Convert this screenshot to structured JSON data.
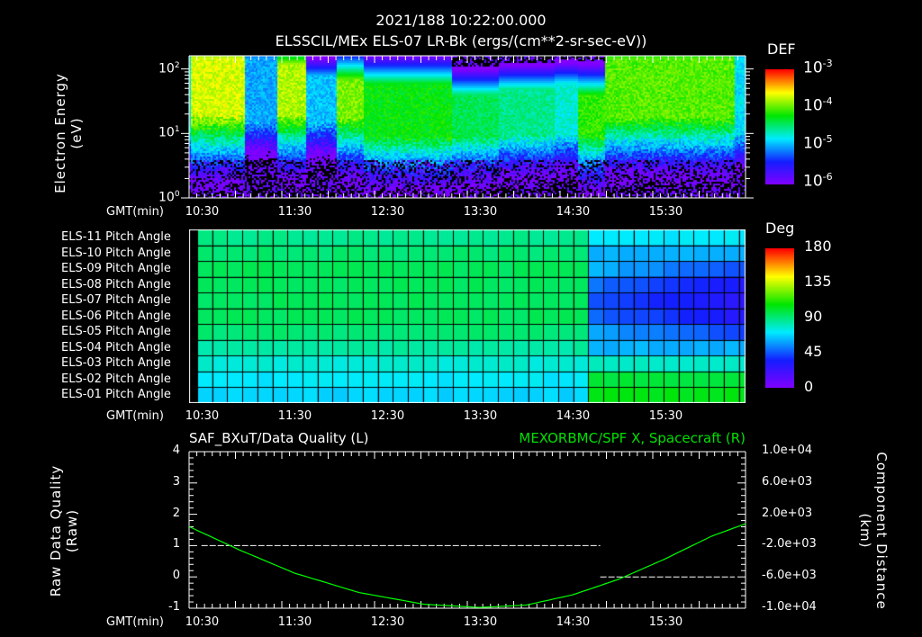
{
  "header": {
    "datetime": "2021/188 10:22:00.000"
  },
  "chart_data": [
    {
      "type": "heatmap",
      "title": "ELSSCIL/MEx ELS-07 LR-Bk  (ergs/(cm**2-sr-sec-eV))",
      "xlabel": "GMT(min)",
      "ylabel": [
        "Electron Energy",
        "(eV)"
      ],
      "y_scale": "log",
      "ylim": [
        1,
        160
      ],
      "y_ticks": [
        {
          "exp": "0",
          "label": "10"
        },
        {
          "exp": "1",
          "label": "10"
        },
        {
          "exp": "2",
          "label": "10"
        }
      ],
      "x_range_hours": [
        10.3667,
        16.3667
      ],
      "x_ticks": [
        "10:30",
        "11:30",
        "12:30",
        "13:30",
        "14:30",
        "15:30"
      ],
      "colorbar": {
        "label": "DEF",
        "scale": "log",
        "range": [
          1e-06,
          0.001
        ],
        "ticks": [
          {
            "base": "10",
            "exp": "-3"
          },
          {
            "base": "10",
            "exp": "-4"
          },
          {
            "base": "10",
            "exp": "-5"
          },
          {
            "base": "10",
            "exp": "-6"
          }
        ]
      },
      "segments": [
        {
          "start": 10.37,
          "end": 10.95,
          "peak_def": 0.0002,
          "band_eV": [
            20,
            150
          ]
        },
        {
          "start": 10.95,
          "end": 11.3,
          "peak_def": 1e-05,
          "band_eV": [
            15,
            150
          ]
        },
        {
          "start": 11.3,
          "end": 11.62,
          "peak_def": 0.00016,
          "band_eV": [
            20,
            120
          ]
        },
        {
          "start": 11.62,
          "end": 11.95,
          "peak_def": 1.2e-05,
          "band_eV": [
            15,
            80
          ]
        },
        {
          "start": 11.95,
          "end": 12.25,
          "peak_def": 0.00012,
          "band_eV": [
            18,
            70
          ]
        },
        {
          "start": 12.25,
          "end": 13.2,
          "peak_def": 6e-05,
          "band_eV": [
            9,
            60
          ]
        },
        {
          "start": 13.2,
          "end": 13.7,
          "peak_def": 4e-05,
          "band_eV": [
            9,
            40
          ]
        },
        {
          "start": 13.7,
          "end": 14.3,
          "peak_def": 3e-05,
          "band_eV": [
            10,
            50
          ]
        },
        {
          "start": 14.3,
          "end": 14.55,
          "peak_def": 2e-05,
          "band_eV": [
            10,
            60
          ]
        },
        {
          "start": 14.55,
          "end": 14.85,
          "peak_def": 8e-05,
          "band_eV": [
            10,
            40
          ]
        },
        {
          "start": 14.85,
          "end": 16.25,
          "peak_def": 0.0001,
          "band_eV": [
            18,
            150
          ]
        },
        {
          "start": 16.25,
          "end": 16.37,
          "peak_def": 1.5e-05,
          "band_eV": [
            10,
            150
          ]
        }
      ]
    },
    {
      "type": "heatmap",
      "xlabel": "GMT(min)",
      "x_ticks": [
        "10:30",
        "11:30",
        "12:30",
        "13:30",
        "14:30",
        "15:30"
      ],
      "colorbar": {
        "label": "Deg",
        "range": [
          0,
          180
        ],
        "ticks": [
          "180",
          "135",
          "90",
          "45",
          "0"
        ]
      },
      "rows": [
        "ELS-11 Pitch Angle",
        "ELS-10 Pitch Angle",
        "ELS-09 Pitch Angle",
        "ELS-08 Pitch Angle",
        "ELS-07 Pitch Angle",
        "ELS-06 Pitch Angle",
        "ELS-05 Pitch Angle",
        "ELS-04 Pitch Angle",
        "ELS-03 Pitch Angle",
        "ELS-02 Pitch Angle",
        "ELS-01 Pitch Angle"
      ],
      "before_1436_deg": [
        88,
        92,
        95,
        95,
        95,
        95,
        92,
        85,
        78,
        72,
        68
      ],
      "after_1436_deg": [
        72,
        62,
        42,
        30,
        26,
        28,
        40,
        62,
        80,
        100,
        105
      ],
      "change_time": "14:36"
    },
    {
      "type": "line",
      "title_left": "SAF_BXuT/Data Quality (L)",
      "title_right": "MEXORBMC/SPF X, Spacecraft (R)",
      "xlabel": "GMT(min)",
      "x_ticks": [
        "10:30",
        "11:30",
        "12:30",
        "13:30",
        "14:30",
        "15:30"
      ],
      "ylabel_left": [
        "Raw  Data  Quality",
        "(Raw)"
      ],
      "ylim_left": [
        -1,
        4
      ],
      "y_ticks_left": [
        "4",
        "3",
        "2",
        "1",
        "0",
        "-1"
      ],
      "ylabel_right": [
        "Component  Distance",
        "(km)"
      ],
      "ylim_right": [
        -10000,
        10000
      ],
      "y_ticks_right": [
        "1.0e+04",
        "6.0e+03",
        "2.0e+03",
        "-2.0e+03",
        "-6.0e+03",
        "-1.0e+04"
      ],
      "series": [
        {
          "name": "Data Quality",
          "axis": "left",
          "color": "#ffffff",
          "style": "dashed",
          "points": [
            [
              10.5,
              1
            ],
            [
              14.8,
              1
            ],
            [
              14.8,
              0
            ],
            [
              16.25,
              0
            ]
          ]
        },
        {
          "name": "SPF X",
          "axis": "right",
          "color": "#00ff00",
          "points": [
            [
              10.37,
              400
            ],
            [
              10.9,
              -2500
            ],
            [
              11.5,
              -5500
            ],
            [
              12.2,
              -8000
            ],
            [
              12.9,
              -9500
            ],
            [
              13.5,
              -9900
            ],
            [
              14.0,
              -9600
            ],
            [
              14.5,
              -8300
            ],
            [
              15.0,
              -6300
            ],
            [
              15.5,
              -3700
            ],
            [
              16.0,
              -800
            ],
            [
              16.37,
              800
            ]
          ]
        }
      ]
    }
  ]
}
